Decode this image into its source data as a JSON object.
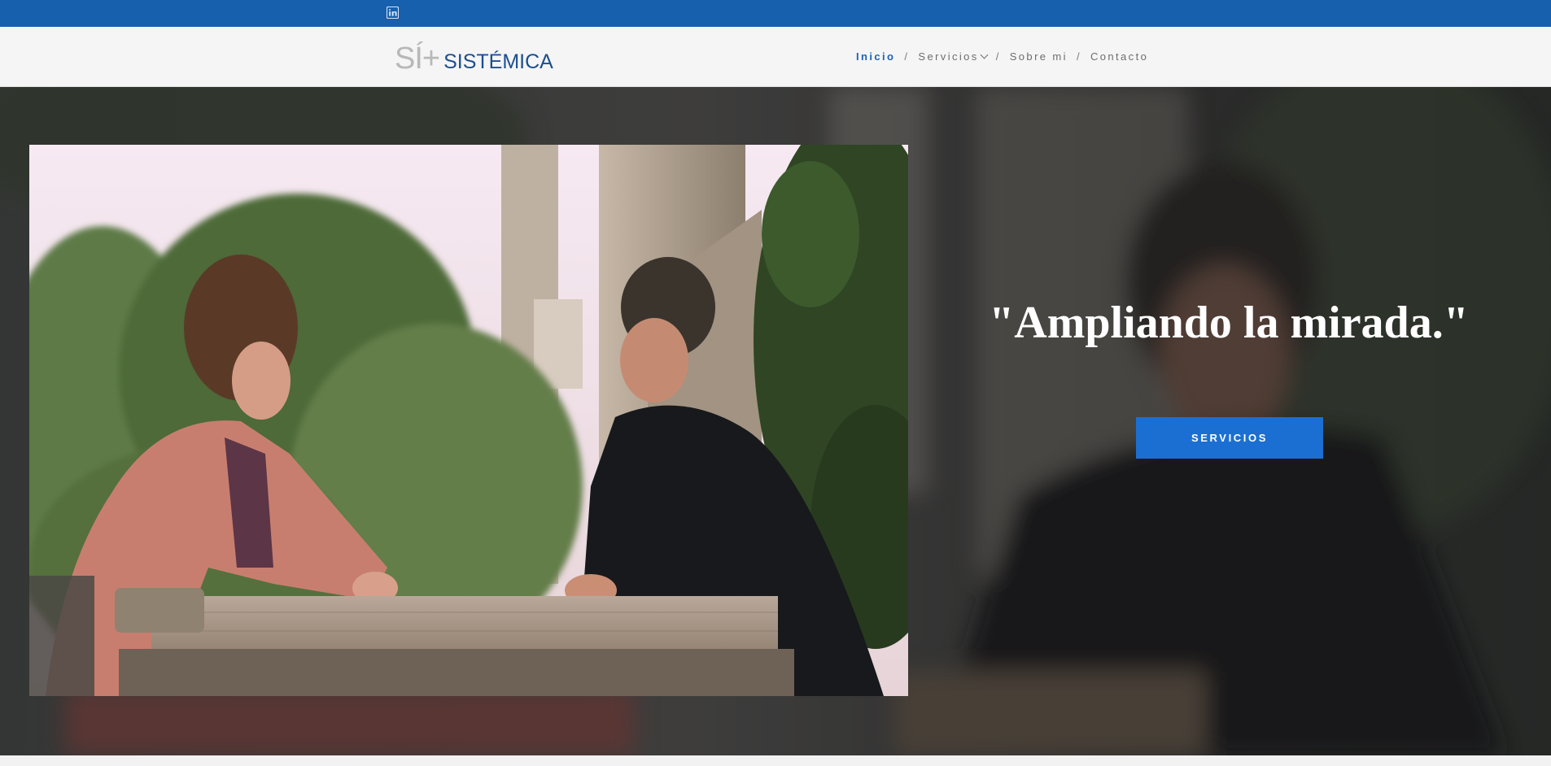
{
  "topbar": {
    "social_icon": "linkedin-icon",
    "background_color": "#1760ad"
  },
  "header": {
    "logo_mark": "SÍ+",
    "logo_text": "SISTÉMICA",
    "logo_mark_color": "#b8b8b8",
    "logo_text_color": "#1d4f8f"
  },
  "nav": {
    "items": [
      {
        "label": "Inicio",
        "active": true
      },
      {
        "label": "Servicios",
        "has_dropdown": true
      },
      {
        "label": "Sobre mi"
      },
      {
        "label": "Contacto"
      }
    ],
    "separator": "/",
    "dropdown_icon": "chevron-down-icon",
    "active_color": "#1d63b5"
  },
  "hero": {
    "tagline": "\"Ampliando la mirada.\"",
    "cta_label": "SERVICIOS",
    "cta_color": "#1c6fd2",
    "image_description_icon": "photo-two-people-at-table"
  }
}
